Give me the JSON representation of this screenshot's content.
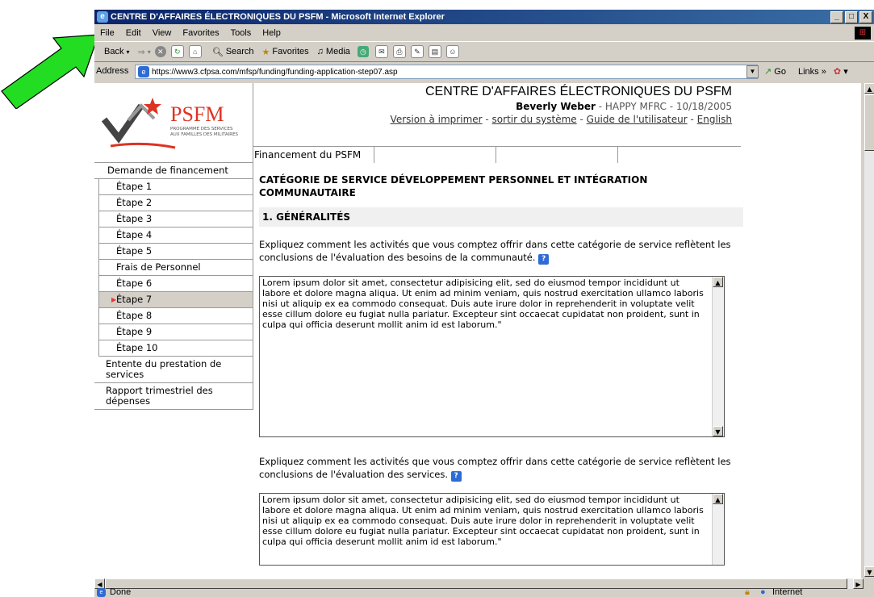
{
  "window": {
    "title": "CENTRE D'AFFAIRES ÉLECTRONIQUES DU PSFM - Microsoft Internet Explorer",
    "buttons": [
      "_",
      "□",
      "X"
    ]
  },
  "menu": [
    "File",
    "Edit",
    "View",
    "Favorites",
    "Tools",
    "Help"
  ],
  "toolbar": {
    "back": "Back",
    "search": "Search",
    "favorites": "Favorites",
    "media": "Media"
  },
  "address": {
    "label": "Address",
    "url": "https://www3.cfpsa.com/mfsp/funding/funding-application-step07.asp",
    "go": "Go",
    "links": "Links"
  },
  "header": {
    "logo_text": "PSFM",
    "logo_sub1": "PROGRAMME DES SERVICES",
    "logo_sub2": "AUX FAMILLES DES MILITAIRES",
    "site_title": "CENTRE D'AFFAIRES ÉLECTRONIQUES DU PSFM",
    "user_name": "Beverly Weber",
    "user_rest": " - HAPPY MFRC - 10/18/2005",
    "link_print": "Version à imprimer",
    "link_logout": "sortir du système",
    "link_guide": "Guide de l'utilisateur",
    "link_english": "English",
    "sep": " - ",
    "tab1": "Financement du PSFM"
  },
  "sidebar": {
    "top": "Demande de financement",
    "steps": [
      "Étape 1",
      "Étape 2",
      "Étape 3",
      "Étape 4",
      "Étape 5",
      "Frais de Personnel",
      "Étape 6",
      "Étape 7",
      "Étape 8",
      "Étape 9",
      "Étape 10"
    ],
    "item2": "Entente du prestation de services",
    "item3": "Rapport trimestriel des dépenses"
  },
  "content": {
    "category_title": "CATÉGORIE DE SERVICE DÉVELOPPEMENT PERSONNEL ET INTÉGRATION COMMUNAUTAIRE",
    "section": "1. GÉNÉRALITÉS",
    "q1": "Expliquez comment les activités que vous comptez offrir dans cette catégorie de service reflètent les conclusions de l'évaluation des besoins de la communauté.",
    "q2": "Expliquez comment les activités que vous comptez offrir dans cette catégorie de service reflètent les conclusions de l'évaluation des services.",
    "lorem": "Lorem ipsum dolor sit amet, consectetur adipisicing elit, sed do eiusmod tempor incididunt ut labore et dolore magna aliqua. Ut enim ad minim veniam, quis nostrud exercitation ullamco laboris nisi ut aliquip ex ea commodo consequat. Duis aute irure dolor in reprehenderit in voluptate velit esse cillum dolore eu fugiat nulla pariatur. Excepteur sint occaecat cupidatat non proident, sunt in culpa qui officia deserunt mollit anim id est laborum.\"",
    "help": "?"
  },
  "status": {
    "text": "Done",
    "zone": "Internet"
  }
}
